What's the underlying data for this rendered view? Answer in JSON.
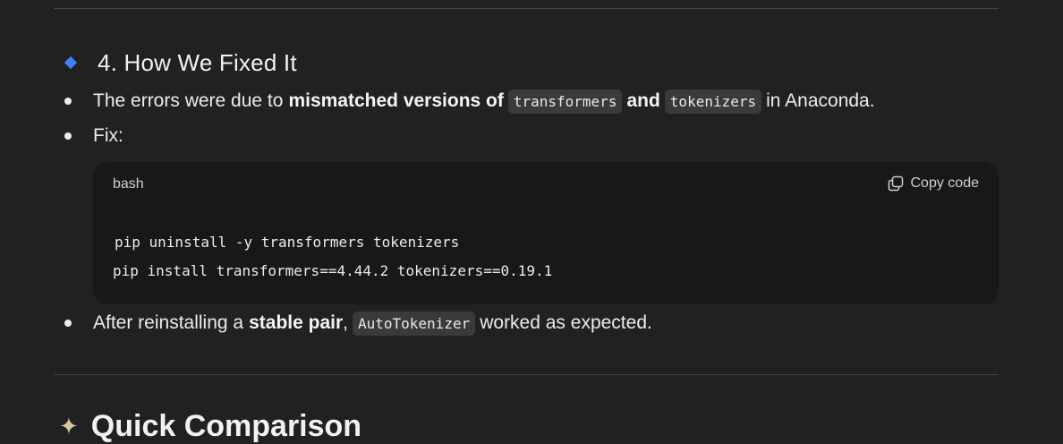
{
  "section": {
    "heading": "4. How We Fixed It"
  },
  "bullets": {
    "b1": {
      "prefix": "The errors were due to",
      "bold": "mismatched versions of",
      "code1": "transformers",
      "and": "and",
      "code2": "tokenizers",
      "suffix": "in Anaconda."
    },
    "b2": {
      "text": "Fix:"
    },
    "b3": {
      "prefix": "After reinstalling a",
      "bold": "stable pair",
      "comma": ",",
      "code": "AutoTokenizer",
      "suffix": "worked as expected."
    }
  },
  "codeblock": {
    "language": "bash",
    "copy_label": "Copy code",
    "copy_icon": "copy-icon",
    "lines": [
      "pip uninstall -y transformers tokenizers",
      "pip install transformers==4.44.2 tokenizers==0.19.1"
    ]
  },
  "next_section": {
    "heading": "Quick Comparison"
  }
}
